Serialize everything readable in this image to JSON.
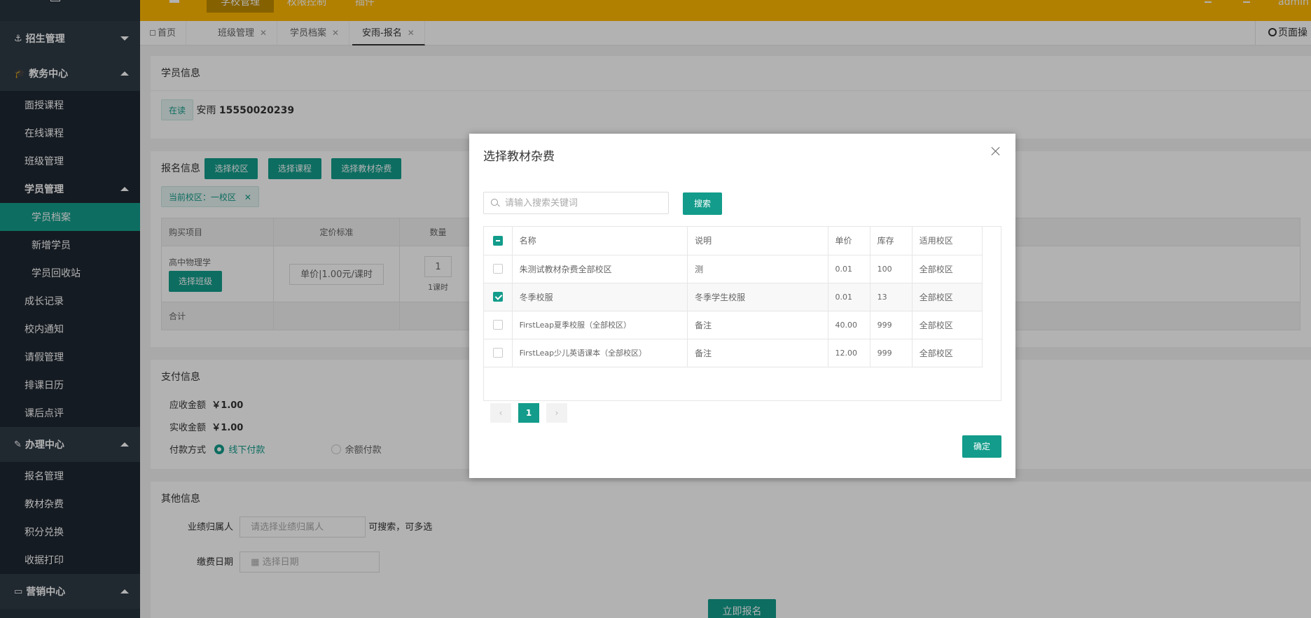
{
  "sidebar": {
    "groups": [
      {
        "label": "招生管理",
        "expanded": false
      },
      {
        "label": "教务中心",
        "expanded": true
      },
      {
        "label": "办理中心",
        "expanded": true
      },
      {
        "label": "营销中心",
        "expanded": true
      }
    ],
    "edu_items": [
      "面授课程",
      "在线课程",
      "班级管理",
      "学员管理"
    ],
    "student_sub": [
      "学员档案",
      "新增学员",
      "学员回收站"
    ],
    "edu_items2": [
      "成长记录",
      "校内通知",
      "请假管理",
      "排课日历",
      "课后点评"
    ],
    "handle_items": [
      "报名管理",
      "教材杂费",
      "积分兑换",
      "收据打印"
    ]
  },
  "topbar": {
    "nav": [
      "学校管理",
      "权限控制",
      "插件"
    ],
    "user": "admin"
  },
  "tabs": [
    "首页",
    "班级管理",
    "学员档案",
    "安雨-报名"
  ],
  "page_op": "页面操",
  "student_info": {
    "title": "学员信息",
    "status": "在读",
    "name": "安雨",
    "phone": "15550020239"
  },
  "signup": {
    "title": "报名信息",
    "buttons": [
      "选择校区",
      "选择课程",
      "选择教材杂费"
    ],
    "current_campus": "当前校区：一校区",
    "table_headers": [
      "购买项目",
      "定价标准",
      "数量"
    ],
    "row_item": "高中物理学",
    "row_btn": "选择班级",
    "row_price": "单价|1.00元/课时",
    "row_qty": "1",
    "row_unit": "1课时",
    "total_label": "合计"
  },
  "payment": {
    "title": "支付信息",
    "receivable_label": "应收金额",
    "receivable": "￥1.00",
    "received_label": "实收金额",
    "received": "￥1.00",
    "method_label": "付款方式",
    "method_offline": "线下付款",
    "method_balance": "余额付款"
  },
  "other": {
    "title": "其他信息",
    "owner_label": "业绩归属人",
    "owner_placeholder": "请选择业绩归属人",
    "owner_hint": "可搜索，可多选",
    "date_label": "缴费日期",
    "date_placeholder": "选择日期",
    "submit": "立即报名"
  },
  "modal": {
    "title": "选择教材杂费",
    "search_placeholder": "请输入搜索关键词",
    "search_btn": "搜索",
    "headers": [
      "名称",
      "说明",
      "单价",
      "库存",
      "适用校区"
    ],
    "rows": [
      {
        "name": "朱测试教材杂费全部校区",
        "desc": "测",
        "price": "0.01",
        "stock": "100",
        "campus": "全部校区",
        "checked": false
      },
      {
        "name": "冬季校服",
        "desc": "冬季学生校服",
        "price": "0.01",
        "stock": "13",
        "campus": "全部校区",
        "checked": true
      },
      {
        "name": "FirstLeap夏季校服（全部校区）",
        "desc": "备注",
        "price": "40.00",
        "stock": "999",
        "campus": "全部校区",
        "checked": false
      },
      {
        "name": "FirstLeap少儿英语课本（全部校区）",
        "desc": "备注",
        "price": "12.00",
        "stock": "999",
        "campus": "全部校区",
        "checked": false
      }
    ],
    "page": "1",
    "prev": "‹",
    "next": "›",
    "confirm": "确定"
  },
  "colors": {
    "accent": "#139c8b",
    "header": "#ffb800",
    "sidebar": "#28333e"
  }
}
